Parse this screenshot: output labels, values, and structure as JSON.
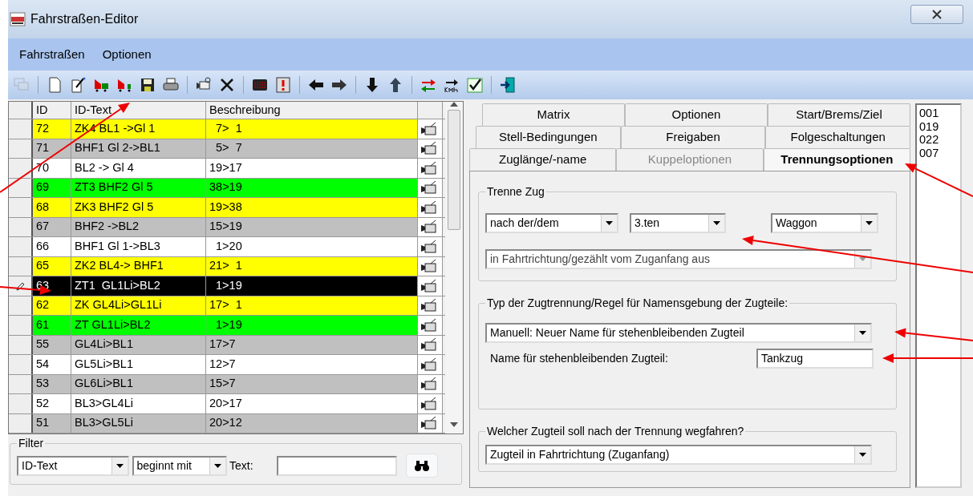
{
  "window": {
    "title": "Fahrstraßen-Editor"
  },
  "menu": [
    {
      "label": "Fahrstraßen"
    },
    {
      "label": "Optionen"
    }
  ],
  "toolbar": [
    {
      "kind": "windows",
      "disabled": true
    },
    {
      "kind": "separator"
    },
    {
      "kind": "new",
      "disabled": false
    },
    {
      "kind": "wand",
      "disabled": false
    },
    {
      "kind": "train-a",
      "disabled": false
    },
    {
      "kind": "train-b",
      "disabled": false
    },
    {
      "kind": "save",
      "disabled": false
    },
    {
      "kind": "print",
      "disabled": false
    },
    {
      "kind": "separator"
    },
    {
      "kind": "camera",
      "disabled": false
    },
    {
      "kind": "delete",
      "disabled": false
    },
    {
      "kind": "separator"
    },
    {
      "kind": "display",
      "disabled": false
    },
    {
      "kind": "warning",
      "disabled": false
    },
    {
      "kind": "separator"
    },
    {
      "kind": "left",
      "disabled": false
    },
    {
      "kind": "right",
      "disabled": false
    },
    {
      "kind": "separator"
    },
    {
      "kind": "down",
      "disabled": false
    },
    {
      "kind": "up",
      "disabled": false
    },
    {
      "kind": "separator"
    },
    {
      "kind": "swap",
      "disabled": false
    },
    {
      "kind": "speed",
      "disabled": false
    },
    {
      "kind": "check",
      "disabled": false
    },
    {
      "kind": "separator"
    },
    {
      "kind": "exit",
      "disabled": false
    }
  ],
  "table": {
    "columns": [
      "ID",
      "ID-Text",
      "Beschreibung"
    ],
    "rows": [
      {
        "id": "72",
        "text": "ZK4 BL1 ->Gl 1",
        "description": "  7>  1",
        "color": "#ffff00",
        "selected": false
      },
      {
        "id": "71",
        "text": "BHF1 Gl 2->BL1",
        "description": "  5>  7",
        "color": "#c0c0c0",
        "selected": false
      },
      {
        "id": "70",
        "text": "BL2 -> Gl 4",
        "description": "19>17",
        "color": "#ffffff",
        "selected": false
      },
      {
        "id": "69",
        "text": "ZT3 BHF2 Gl 5",
        "description": "38>19",
        "color": "#00ff00",
        "selected": false
      },
      {
        "id": "68",
        "text": "ZK3 BHF2 Gl 5",
        "description": "19>38",
        "color": "#ffff00",
        "selected": false
      },
      {
        "id": "67",
        "text": "BHF2 ->BL2",
        "description": "15>19",
        "color": "#c0c0c0",
        "selected": false
      },
      {
        "id": "66",
        "text": "BHF1 Gl 1->BL3",
        "description": "  1>20",
        "color": "#ffffff",
        "selected": false
      },
      {
        "id": "65",
        "text": "ZK2 BL4-> BHF1",
        "description": "21>  1",
        "color": "#ffff00",
        "selected": false
      },
      {
        "id": "63",
        "text": "ZT1  GL1Li>BL2",
        "description": "  1>19",
        "selected": true
      },
      {
        "id": "62",
        "text": "ZK GL4Li>GL1Li",
        "description": "17>  1",
        "color": "#ffff00",
        "selected": false
      },
      {
        "id": "61",
        "text": "ZT GL1Li>BL2",
        "description": "  1>19",
        "color": "#00ff00",
        "selected": false
      },
      {
        "id": "55",
        "text": "GL4Li>BL1",
        "description": "17>7",
        "color": "#c0c0c0",
        "selected": false
      },
      {
        "id": "54",
        "text": "GL5Li>BL1",
        "description": "12>7",
        "color": "#ffffff",
        "selected": false
      },
      {
        "id": "53",
        "text": "GL6Li>BL1",
        "description": "15>7",
        "color": "#c0c0c0",
        "selected": false
      },
      {
        "id": "52",
        "text": "BL3>GL4Li",
        "description": "20>17",
        "color": "#ffffff",
        "selected": false
      },
      {
        "id": "51",
        "text": "BL3>GL5Li",
        "description": "20>12",
        "color": "#c0c0c0",
        "selected": false
      }
    ]
  },
  "filter": {
    "legend": "Filter",
    "field": "ID-Text",
    "mode": "beginnt mit",
    "text_label": "Text:"
  },
  "tab_rows": [
    {
      "tabs": [
        {
          "label": "Matrix",
          "selected": false,
          "disabled": false
        },
        {
          "label": "Optionen",
          "selected": false,
          "disabled": false
        },
        {
          "label": "Start/Brems/Ziel",
          "selected": false,
          "disabled": false
        }
      ]
    },
    {
      "tabs": [
        {
          "label": "Stell-Bedingungen",
          "selected": false,
          "disabled": false
        },
        {
          "label": "Freigaben",
          "selected": false,
          "disabled": false
        },
        {
          "label": "Folgeschaltungen",
          "selected": false,
          "disabled": false
        }
      ]
    },
    {
      "tabs": [
        {
          "label": "Zuglänge/-name",
          "selected": false,
          "disabled": false
        },
        {
          "label": "Kuppeloptionen",
          "selected": false,
          "disabled": true
        },
        {
          "label": "Trennungsoptionen",
          "selected": true,
          "disabled": false
        }
      ]
    }
  ],
  "split_train": {
    "legend": "Trenne Zug",
    "position": {
      "value": "nach der/dem",
      "disabled": false
    },
    "count": {
      "value": "3.ten",
      "disabled": false
    },
    "unit": {
      "value": "Waggon",
      "disabled": false
    },
    "direction": {
      "value": "in Fahrtrichtung/gezählt vom Zuganfang aus",
      "disabled": true
    }
  },
  "split_type": {
    "legend": "Typ der Zugtrennung/Regel für Namensgebung der Zugteile:",
    "rule": {
      "value": "Manuell: Neuer Name für stehenbleibenden Zugteil",
      "disabled": false
    },
    "name_label": "Name für stehenbleibenden Zugteil:",
    "name_value": "Tankzug"
  },
  "departing_part": {
    "legend": "Welcher Zugteil soll nach der Trennung wegfahren?",
    "choice": {
      "value": "Zugteil in Fahrtrichtung (Zuganfang)",
      "disabled": false
    }
  },
  "side_list": [
    "001",
    "019",
    "022",
    "007"
  ]
}
